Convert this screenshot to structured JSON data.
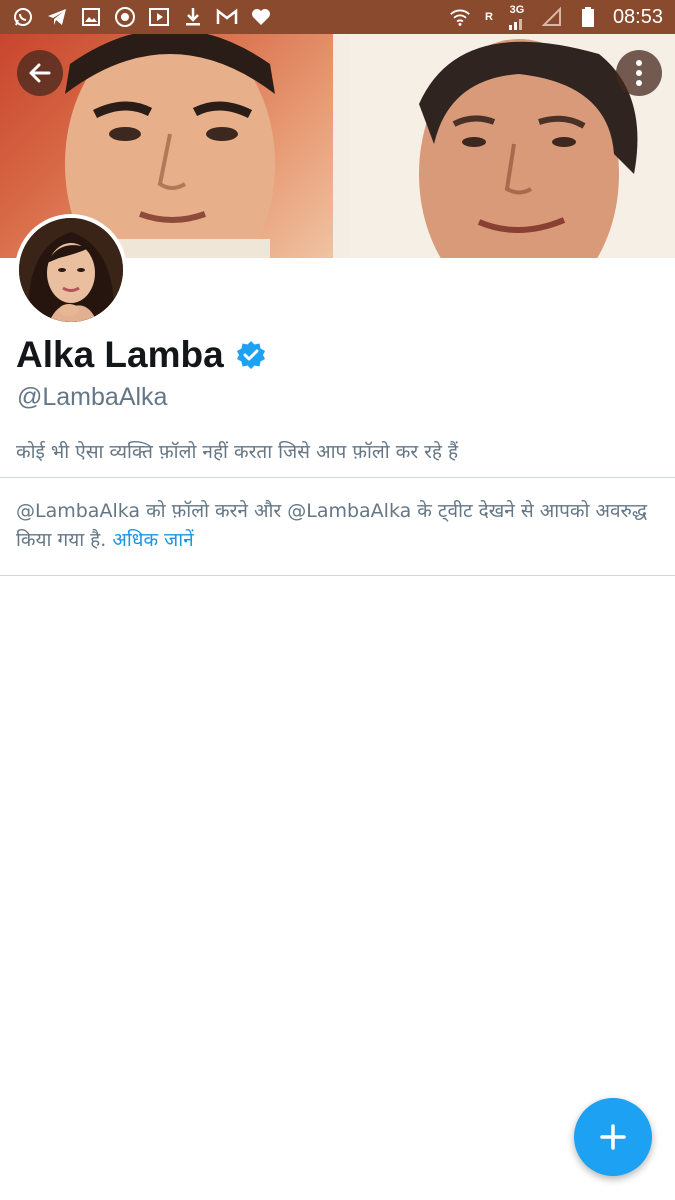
{
  "status_bar": {
    "time": "08:53",
    "network_badge": "3G",
    "roaming_badge": "R",
    "left_icons": [
      "whatsapp-icon",
      "telegram-icon",
      "gallery-icon",
      "chrome-icon",
      "video-icon",
      "download-icon",
      "gmail-icon",
      "heart-icon"
    ],
    "right_icons": [
      "wifi-icon",
      "signal-icon",
      "signal-empty-icon",
      "battery-icon"
    ]
  },
  "profile": {
    "name": "Alka Lamba",
    "handle": "@LambaAlka",
    "verified": true,
    "followed_by_text": "कोई भी ऐसा व्यक्ति फ़ॉलो नहीं करता जिसे आप फ़ॉलो कर रहे हैं",
    "blocked_text": "@LambaAlka को फ़ॉलो करने और @LambaAlka के ट्वीट देखने से आपको अवरुद्ध किया गया है.",
    "learn_more": "अधिक जानें"
  },
  "colors": {
    "status_bar": "#8a4a2e",
    "accent": "#1da1f2",
    "link": "#1b95e0",
    "secondary_text": "#657786",
    "primary_text": "#14171a"
  },
  "icons": {
    "back": "arrow-left-icon",
    "more": "more-vertical-icon",
    "verified": "verified-badge-icon",
    "compose": "plus-icon"
  }
}
